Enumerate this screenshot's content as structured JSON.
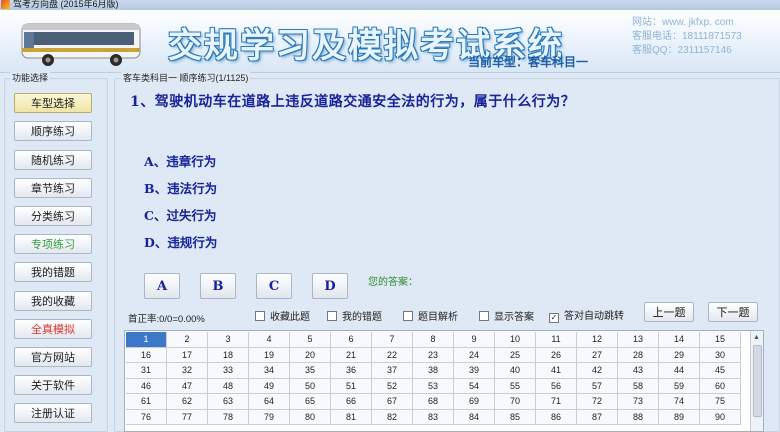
{
  "window": {
    "title": "驾考方向盘 (2015年6月版)"
  },
  "banner": {
    "title": "交规学习及模拟考试系统",
    "current_car_label": "当前车型：",
    "current_car_value": "客车科目一",
    "website": "网站：www. jkfxp. com",
    "phone": "客服电话：18111871573",
    "qq": "客服QQ：2311157146"
  },
  "sidebar": {
    "legend": "功能选择",
    "items": [
      {
        "label": "车型选择",
        "style": "active"
      },
      {
        "label": "顺序练习",
        "style": "normal"
      },
      {
        "label": "随机练习",
        "style": "normal"
      },
      {
        "label": "章节练习",
        "style": "normal"
      },
      {
        "label": "分类练习",
        "style": "normal"
      },
      {
        "label": "专项练习",
        "style": "green"
      },
      {
        "label": "我的错题",
        "style": "normal"
      },
      {
        "label": "我的收藏",
        "style": "normal"
      },
      {
        "label": "全真模拟",
        "style": "red"
      },
      {
        "label": "官方网站",
        "style": "normal"
      },
      {
        "label": "关于软件",
        "style": "normal"
      },
      {
        "label": "注册认证",
        "style": "normal"
      }
    ]
  },
  "content": {
    "legend": "客车类科目一  顺序练习(1/1125)",
    "question": "1、驾驶机动车在道路上违反道路交通安全法的行为，属于什么行为？",
    "options": [
      "A、违章行为",
      "B、违法行为",
      "C、过失行为",
      "D、违规行为"
    ],
    "answer_buttons": [
      "A",
      "B",
      "C",
      "D"
    ],
    "your_answer_label": "您的答案：",
    "accuracy": "首正率:0/0=0.00%",
    "checkboxes": [
      {
        "label": "收藏此题",
        "checked": false
      },
      {
        "label": "我的错题",
        "checked": false
      },
      {
        "label": "题目解析",
        "checked": false
      },
      {
        "label": "显示答案",
        "checked": false
      },
      {
        "label": "答对自动跳转",
        "checked": true
      }
    ],
    "prev_button": "上一题",
    "next_button": "下一题",
    "selected_question": 1,
    "grid_numbers": [
      "1",
      "2",
      "3",
      "4",
      "5",
      "6",
      "7",
      "8",
      "9",
      "10",
      "11",
      "12",
      "13",
      "14",
      "15",
      "16",
      "17",
      "18",
      "19",
      "20",
      "21",
      "22",
      "23",
      "24",
      "25",
      "26",
      "27",
      "28",
      "29",
      "30",
      "31",
      "32",
      "33",
      "34",
      "35",
      "36",
      "37",
      "38",
      "39",
      "40",
      "41",
      "42",
      "43",
      "44",
      "45",
      "46",
      "47",
      "48",
      "49",
      "50",
      "51",
      "52",
      "53",
      "54",
      "55",
      "56",
      "57",
      "58",
      "59",
      "60",
      "61",
      "62",
      "63",
      "64",
      "65",
      "66",
      "67",
      "68",
      "69",
      "70",
      "71",
      "72",
      "73",
      "74",
      "75",
      "76",
      "77",
      "78",
      "79",
      "80",
      "81",
      "82",
      "83",
      "84",
      "85",
      "86",
      "87",
      "88",
      "89",
      "90"
    ]
  },
  "colors": {
    "accent": "#3b78c7",
    "question_text": "#17239a",
    "green_item": "#2f9b3a",
    "red_item": "#e0312b"
  }
}
